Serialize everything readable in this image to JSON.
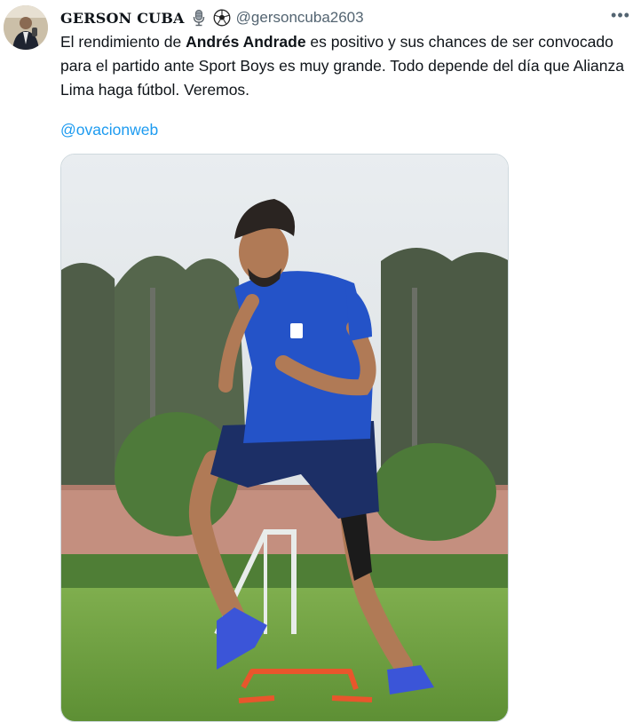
{
  "tweet": {
    "author_name": "GERSON CUBA",
    "author_handle": "@gersoncuba2603",
    "badges": [
      "microphone-icon",
      "soccer-ball-icon"
    ],
    "text_parts": [
      {
        "text": "El rendimiento de ",
        "bold": false
      },
      {
        "text": "Andrés Andrade",
        "bold": true
      },
      {
        "text": " es positivo y sus chances de ser convocado para el partido ante Sport Boys es muy grande. Todo depende del día que Alianza Lima haga fútbol. Veremos.",
        "bold": false
      }
    ],
    "mention": "@ovacionweb",
    "more_icon": "more-horizontal-icon"
  },
  "colors": {
    "link": "#1d9bf0",
    "secondary_text": "#536471",
    "primary_text": "#0f1419",
    "jersey_blue": "#2453c8",
    "hurdle_orange": "#e8562c"
  }
}
